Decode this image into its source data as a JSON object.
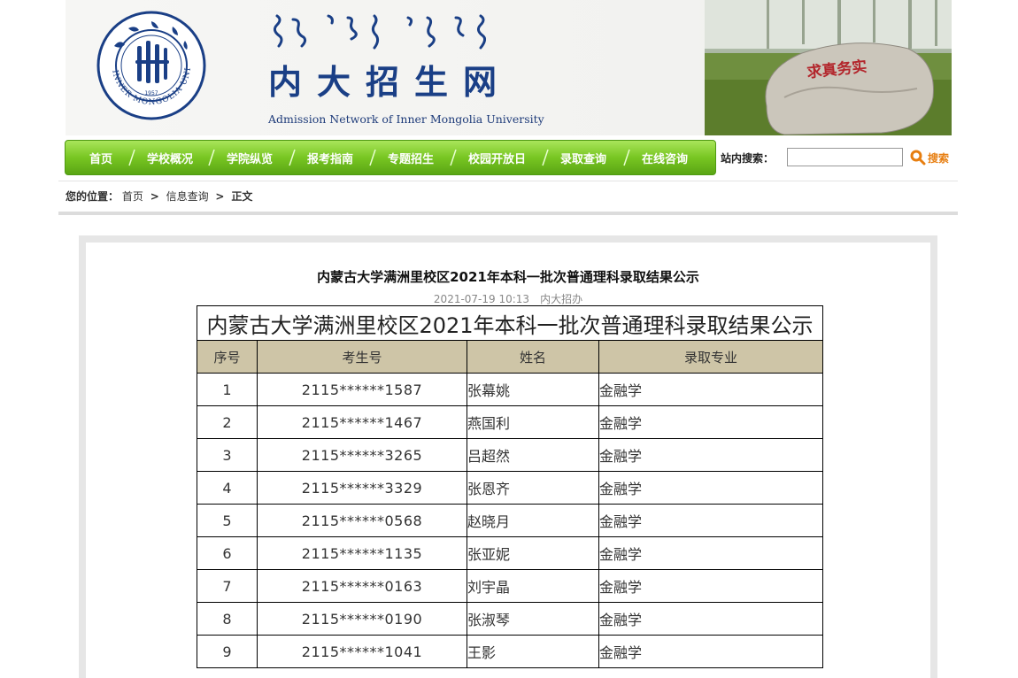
{
  "header": {
    "site_title": "内大招生网",
    "site_subtitle": "Admission Network of Inner Mongolia University",
    "logo_ring_text": "INNER MONGOLIA UNIVERSITY",
    "logo_year": "1957",
    "rock_inscription": "求真务实",
    "brand_color": "#1a3f86"
  },
  "nav": {
    "items": [
      "首页",
      "学校概况",
      "学院纵览",
      "报考指南",
      "专题招生",
      "校园开放日",
      "录取查询",
      "在线咨询"
    ],
    "nav_color": "#78c622"
  },
  "search": {
    "label": "站内搜索：",
    "placeholder": "",
    "button_label": "搜索"
  },
  "breadcrumb": {
    "label": "您的位置：",
    "items": [
      "首页",
      "信息查询",
      "正文"
    ]
  },
  "article": {
    "title": "内蒙古大学满洲里校区2021年本科一批次普通理科录取结果公示",
    "date": "2021-07-19 10:13",
    "source": "内大招办"
  },
  "table": {
    "caption": "内蒙古大学满洲里校区2021年本科一批次普通理科录取结果公示",
    "headers": [
      "序号",
      "考生号",
      "姓名",
      "录取专业"
    ],
    "header_bg": "#cec5a7",
    "rows": [
      [
        "1",
        "2115******1587",
        "张幕姚",
        "金融学"
      ],
      [
        "2",
        "2115******1467",
        "燕国利",
        "金融学"
      ],
      [
        "3",
        "2115******3265",
        "吕超然",
        "金融学"
      ],
      [
        "4",
        "2115******3329",
        "张恩齐",
        "金融学"
      ],
      [
        "5",
        "2115******0568",
        "赵晓月",
        "金融学"
      ],
      [
        "6",
        "2115******1135",
        "张亚妮",
        "金融学"
      ],
      [
        "7",
        "2115******0163",
        "刘宇晶",
        "金融学"
      ],
      [
        "8",
        "2115******0190",
        "张淑琴",
        "金融学"
      ],
      [
        "9",
        "2115******1041",
        "王影",
        "金融学"
      ]
    ]
  }
}
